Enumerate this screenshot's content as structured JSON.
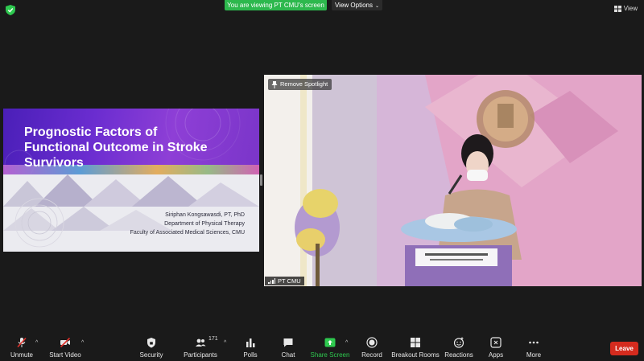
{
  "top_bar": {
    "banner": "You are viewing PT CMU's screen",
    "view_options": "View Options",
    "view": "View"
  },
  "slide": {
    "title": "Prognostic Factors of\nFunctional Outcome in Stroke\nSurvivors",
    "author": "Siriphan Kongsawasdi, PT, PhD",
    "department": "Department of Physical Therapy",
    "faculty": "Faculty of Associated Medical Sciences, CMU"
  },
  "video": {
    "remove_spotlight": "Remove Spotlight",
    "participant_name": "PT CMU"
  },
  "toolbar": {
    "unmute": "Unmute",
    "start_video": "Start Video",
    "security": "Security",
    "participants": "Participants",
    "participants_count": "171",
    "polls": "Polls",
    "chat": "Chat",
    "share_screen": "Share Screen",
    "record": "Record",
    "breakout_rooms": "Breakout Rooms",
    "reactions": "Reactions",
    "apps": "Apps",
    "more": "More",
    "leave": "Leave"
  },
  "colors": {
    "banner_green": "#2db84d",
    "leave_red": "#d52b1e",
    "share_green": "#2ec94f",
    "mute_red": "#e0302a"
  },
  "icons": [
    "shield-icon",
    "grid-view-icon",
    "chevron-down-icon",
    "pin-icon",
    "signal-icon",
    "mic-muted-icon",
    "video-off-icon",
    "security-icon",
    "participants-icon",
    "polls-icon",
    "chat-icon",
    "share-screen-icon",
    "record-icon",
    "breakout-rooms-icon",
    "reactions-icon",
    "apps-icon",
    "more-icon"
  ]
}
